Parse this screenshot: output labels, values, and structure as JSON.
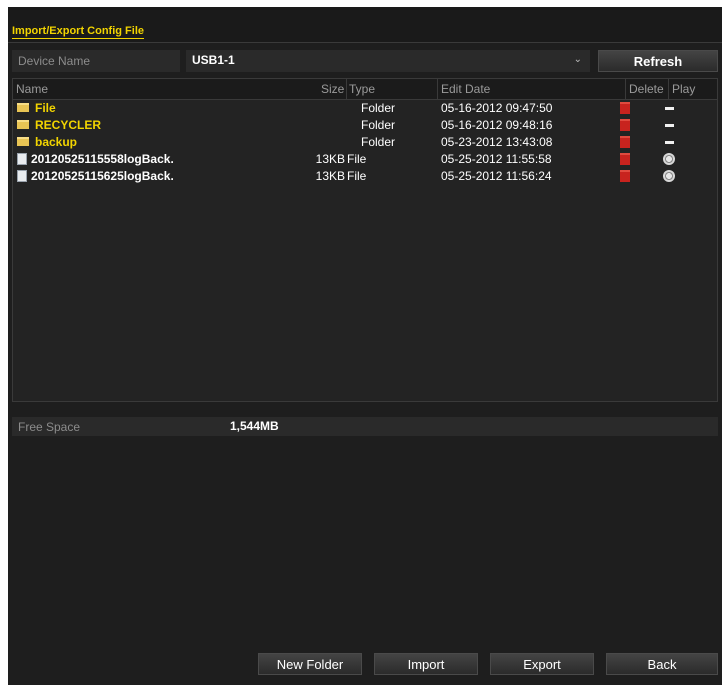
{
  "title": "Import/Export Config File",
  "device": {
    "label": "Device Name",
    "value": "USB1-1",
    "refresh_label": "Refresh"
  },
  "table": {
    "headers": {
      "name": "Name",
      "size": "Size",
      "type": "Type",
      "edit_date": "Edit Date",
      "delete": "Delete",
      "play": "Play"
    },
    "rows": [
      {
        "name": "File",
        "size": "",
        "type": "Folder",
        "edit_date": "05-16-2012 09:47:50",
        "kind": "folder"
      },
      {
        "name": "RECYCLER",
        "size": "",
        "type": "Folder",
        "edit_date": "05-16-2012 09:48:16",
        "kind": "folder"
      },
      {
        "name": "backup",
        "size": "",
        "type": "Folder",
        "edit_date": "05-23-2012 13:43:08",
        "kind": "folder"
      },
      {
        "name": "20120525115558logBack.",
        "size": "13KB",
        "type": "File",
        "edit_date": "05-25-2012 11:55:58",
        "kind": "file"
      },
      {
        "name": "20120525115625logBack.",
        "size": "13KB",
        "type": "File",
        "edit_date": "05-25-2012 11:56:24",
        "kind": "file"
      }
    ]
  },
  "free_space": {
    "label": "Free Space",
    "value": "1,544MB"
  },
  "buttons": {
    "new_folder": "New Folder",
    "import": "Import",
    "export": "Export",
    "back": "Back"
  },
  "colors": {
    "accent": "#f2d400",
    "folder_text": "#f2d400",
    "delete_icon": "#c8231e"
  }
}
